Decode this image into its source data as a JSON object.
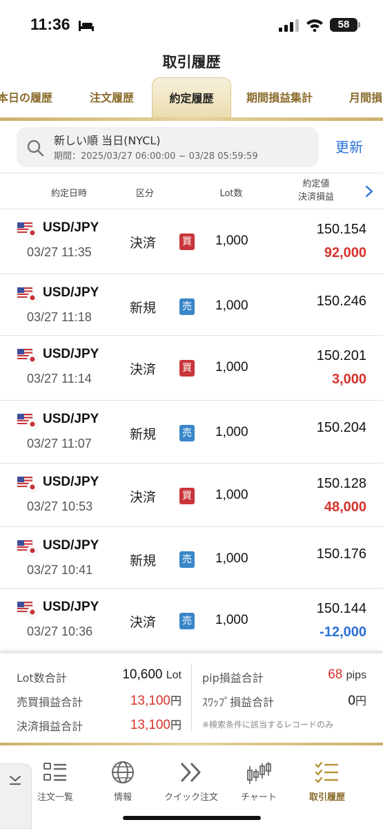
{
  "status_bar": {
    "time": "11:36",
    "battery": "58"
  },
  "title": "取引履歴",
  "tabs": [
    {
      "label": "本日の履歴"
    },
    {
      "label": "注文履歴"
    },
    {
      "label": "約定履歴",
      "active": true
    },
    {
      "label": "期間損益集計"
    },
    {
      "label": "月間損"
    }
  ],
  "search": {
    "condition": "新しい順 当日(NYCL)",
    "period": "期間：2025/03/27 06:00:00 ~ 03/28 05:59:59",
    "refresh_label": "更新"
  },
  "table_header": {
    "date": "約定日時",
    "kind": "区分",
    "lot": "Lot数",
    "price": "約定値",
    "pl": "決済損益"
  },
  "rows": [
    {
      "pair": "USD/JPY",
      "datetime": "03/27 11:35",
      "kind": "決済",
      "side": "買",
      "side_type": "buy",
      "lot": "1,000",
      "price": "150.154",
      "pl": "92,000",
      "pl_sign": "pos"
    },
    {
      "pair": "USD/JPY",
      "datetime": "03/27 11:18",
      "kind": "新規",
      "side": "売",
      "side_type": "sell",
      "lot": "1,000",
      "price": "150.246",
      "pl": "",
      "pl_sign": ""
    },
    {
      "pair": "USD/JPY",
      "datetime": "03/27 11:14",
      "kind": "決済",
      "side": "買",
      "side_type": "buy",
      "lot": "1,000",
      "price": "150.201",
      "pl": "3,000",
      "pl_sign": "pos"
    },
    {
      "pair": "USD/JPY",
      "datetime": "03/27 11:07",
      "kind": "新規",
      "side": "売",
      "side_type": "sell",
      "lot": "1,000",
      "price": "150.204",
      "pl": "",
      "pl_sign": ""
    },
    {
      "pair": "USD/JPY",
      "datetime": "03/27 10:53",
      "kind": "決済",
      "side": "買",
      "side_type": "buy",
      "lot": "1,000",
      "price": "150.128",
      "pl": "48,000",
      "pl_sign": "pos"
    },
    {
      "pair": "USD/JPY",
      "datetime": "03/27 10:41",
      "kind": "新規",
      "side": "売",
      "side_type": "sell",
      "lot": "1,000",
      "price": "150.176",
      "pl": "",
      "pl_sign": ""
    },
    {
      "pair": "USD/JPY",
      "datetime": "03/27 10:36",
      "kind": "決済",
      "side": "売",
      "side_type": "sell",
      "lot": "1,000",
      "price": "150.144",
      "pl": "-12,000",
      "pl_sign": "neg"
    }
  ],
  "summary": {
    "lot_total_label": "Lot数合計",
    "lot_total_value": "10,600",
    "lot_total_unit": "Lot",
    "trade_pl_label": "売買損益合計",
    "trade_pl_value": "13,100",
    "trade_pl_unit": "円",
    "settle_pl_label": "決済損益合計",
    "settle_pl_value": "13,100",
    "settle_pl_unit": "円",
    "pip_pl_label": "pip損益合計",
    "pip_pl_value": "68",
    "pip_pl_unit": "pips",
    "swap_pl_label": "ｽﾜｯﾌﾟ損益合計",
    "swap_pl_value": "0",
    "swap_pl_unit": "円",
    "note": "※検索条件に該当するレコードのみ"
  },
  "nav": [
    {
      "label": "注文一覧",
      "icon": "list-icon"
    },
    {
      "label": "情報",
      "icon": "globe-icon"
    },
    {
      "label": "クイック注文",
      "icon": "double-chevron-icon"
    },
    {
      "label": "チャート",
      "icon": "candlestick-icon"
    },
    {
      "label": "取引履歴",
      "icon": "checklist-icon",
      "active": true
    }
  ],
  "colors": {
    "accent_gold": "#8a6a2a",
    "link_blue": "#2a73d9",
    "profit_red": "#d6322a",
    "loss_blue": "#2a6fd6",
    "buy_red": "#c8353a",
    "sell_blue": "#3a86c8"
  }
}
